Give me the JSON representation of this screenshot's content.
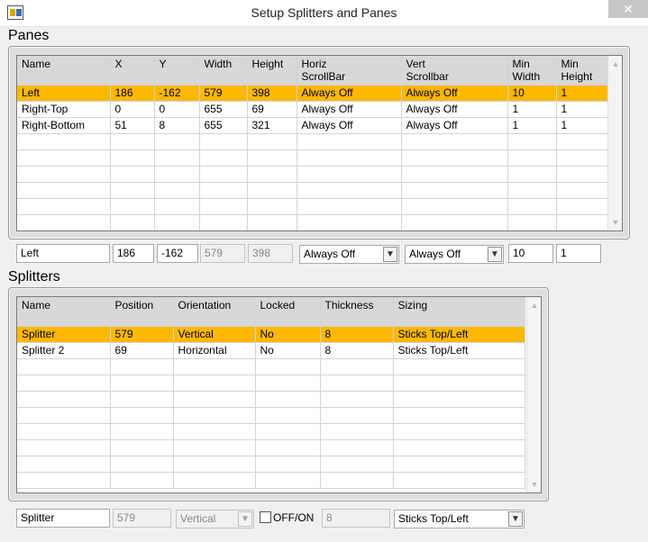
{
  "window": {
    "title": "Setup Splitters and Panes",
    "close_glyph": "✕"
  },
  "panes": {
    "label": "Panes",
    "columns": [
      "Name",
      "X",
      "Y",
      "Width",
      "Height",
      "Horiz\nScrollBar",
      "Vert\nScrollbar",
      "Min\nWidth",
      "Min\nHeight"
    ],
    "rows": [
      [
        "Left",
        "186",
        "-162",
        "579",
        "398",
        "Always Off",
        "Always Off",
        "10",
        "1"
      ],
      [
        "Right-Top",
        "0",
        "0",
        "655",
        "69",
        "Always Off",
        "Always Off",
        "1",
        "1"
      ],
      [
        "Right-Bottom",
        "51",
        "8",
        "655",
        "321",
        "Always Off",
        "Always Off",
        "1",
        "1"
      ]
    ],
    "selected_row": 0,
    "editor": {
      "name": "Left",
      "x": "186",
      "y": "-162",
      "width": "579",
      "height": "398",
      "horiz_scrollbar": "Always Off",
      "vert_scrollbar": "Always Off",
      "min_width": "10",
      "min_height": "1"
    }
  },
  "splitters": {
    "label": "Splitters",
    "columns": [
      "Name",
      "Position",
      "Orientation",
      "Locked",
      "Thickness",
      "Sizing"
    ],
    "rows": [
      [
        "Splitter",
        "579",
        "Vertical",
        "No",
        "8",
        "Sticks Top/Left"
      ],
      [
        "Splitter 2",
        "69",
        "Horizontal",
        "No",
        "8",
        "Sticks Top/Left"
      ]
    ],
    "selected_row": 0,
    "editor": {
      "name": "Splitter",
      "position": "579",
      "orientation": "Vertical",
      "locked_label": "OFF/ON",
      "thickness": "8",
      "sizing": "Sticks Top/Left"
    }
  },
  "colors": {
    "selection": "#ffb800",
    "header": "#d8d8d8"
  },
  "icons": {
    "dropdown": "chevron-down-icon",
    "scroll_up": "arrow-up-icon",
    "scroll_down": "arrow-down-icon"
  }
}
